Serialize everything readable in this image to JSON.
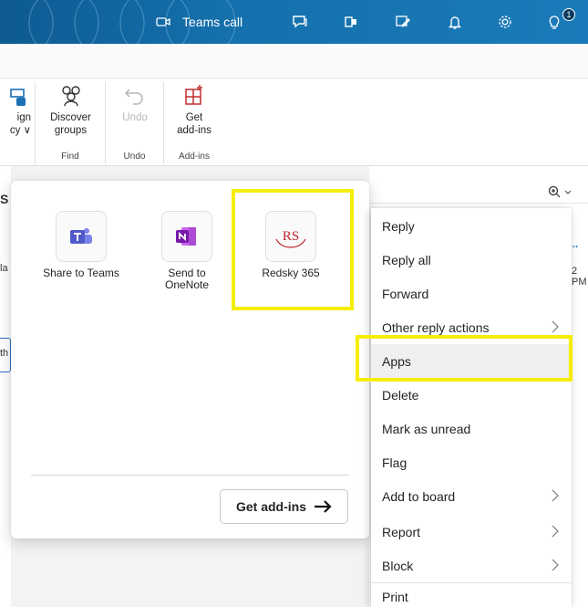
{
  "titlebar": {
    "teams_call_label": "Teams call",
    "notification_count": "1",
    "icons": [
      "camera-icon",
      "chat-icon",
      "office-icon",
      "pen-icon",
      "bell-icon",
      "gear-icon",
      "lightbulb-icon"
    ]
  },
  "ribbon": {
    "partial_label_1": "ign",
    "partial_label_2": "cy ∨",
    "discover_line1": "Discover",
    "discover_line2": "groups",
    "find_group": "Find",
    "undo_label": "Undo",
    "undo_group": "Undo",
    "get_line1": "Get",
    "get_line2": "add-ins",
    "addins_group": "Add-ins"
  },
  "background": {
    "left_s": "S",
    "left_la": "la",
    "left_th": "th",
    "time_partial": "2 PM",
    "ellipsis": "..."
  },
  "apps_panel": {
    "apps": [
      {
        "name": "Share to Teams",
        "icon": "teams-icon"
      },
      {
        "name": "Send to OneNote",
        "icon": "onenote-icon"
      },
      {
        "name": "Redsky 365",
        "icon": "redsky-icon"
      }
    ],
    "send_line1": "Send to",
    "send_line2": "OneNote",
    "get_addins_label": "Get add-ins"
  },
  "context_menu": {
    "items": [
      {
        "label": "Reply"
      },
      {
        "label": "Reply all"
      },
      {
        "label": "Forward"
      },
      {
        "label": "Other reply actions",
        "submenu": true
      },
      {
        "label": "Apps",
        "selected": true
      },
      {
        "label": "Delete"
      },
      {
        "label": "Mark as unread"
      },
      {
        "label": "Flag"
      },
      {
        "label": "Add to board",
        "submenu": true
      },
      {
        "label": "Report",
        "submenu": true
      },
      {
        "label": "Block",
        "submenu": true
      },
      {
        "label": "Print"
      }
    ]
  },
  "colors": {
    "titlebar": "#1571ad",
    "highlight": "#f5ee00",
    "teams": "#5059c9",
    "onenote": "#7719aa",
    "redsky": "#c0272d"
  }
}
